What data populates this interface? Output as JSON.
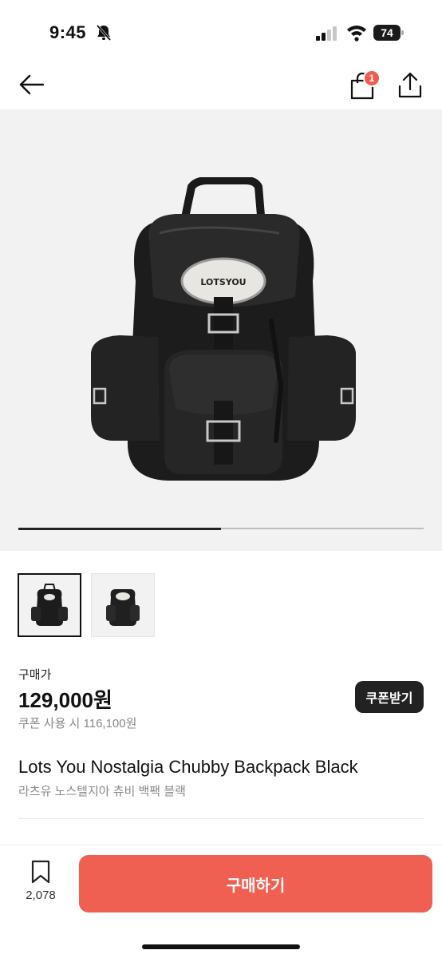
{
  "status_bar": {
    "time": "9:45",
    "battery": "74"
  },
  "nav": {
    "cart_badge": "1"
  },
  "gallery": {
    "progress": 0.5,
    "thumbnail_count": 2
  },
  "product": {
    "price_label": "구매가",
    "price": "129,000원",
    "coupon_price": "쿠폰 사용 시 116,100원",
    "coupon_button": "쿠폰받기",
    "title": "Lots You Nostalgia Chubby Backpack Black",
    "subtitle": "라츠유 노스텔지아 츄비 백팩 블랙"
  },
  "bottom_bar": {
    "wish_count": "2,078",
    "buy_label": "구매하기"
  },
  "colors": {
    "accent": "#ef5f52",
    "badge": "#ef5b4f",
    "dark": "#222222"
  }
}
